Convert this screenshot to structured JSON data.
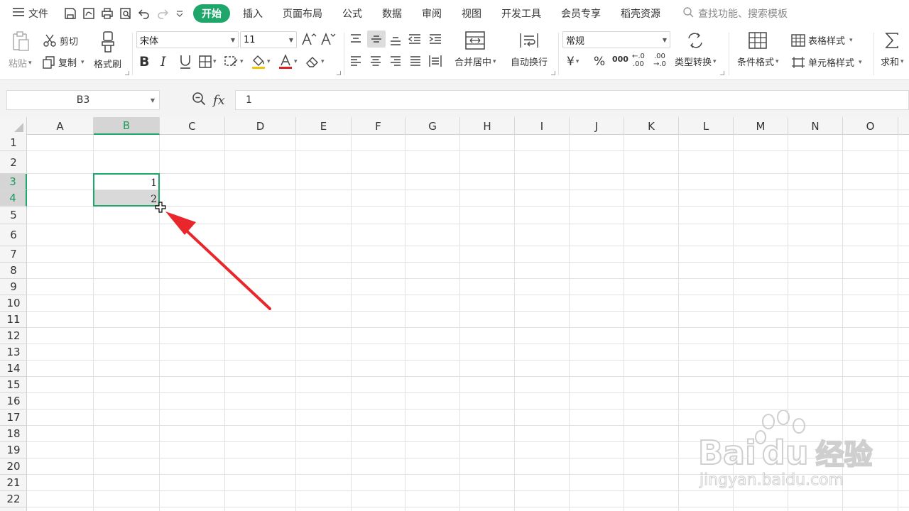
{
  "menubar": {
    "menu_label": "文件",
    "tabs": [
      {
        "label": "开始",
        "active": true
      },
      {
        "label": "插入"
      },
      {
        "label": "页面布局"
      },
      {
        "label": "公式"
      },
      {
        "label": "数据"
      },
      {
        "label": "审阅"
      },
      {
        "label": "视图"
      },
      {
        "label": "开发工具"
      },
      {
        "label": "会员专享"
      },
      {
        "label": "稻壳资源"
      }
    ],
    "search_placeholder": "查找功能、搜索模板"
  },
  "ribbon": {
    "paste": "粘贴",
    "cut": "剪切",
    "copy": "复制",
    "format_painter": "格式刷",
    "font_name": "宋体",
    "font_size": "11",
    "merge_center": "合并居中",
    "wrap_text": "自动换行",
    "number_format": "常规",
    "type_convert": "类型转换",
    "conditional_format": "条件格式",
    "table_style": "表格样式",
    "cell_style": "单元格样式",
    "sum": "求和",
    "percent": "%",
    "thousands": "000",
    "dec_increase_top": "←.0",
    "dec_increase_bottom": ".00",
    "dec_decrease_top": ".00",
    "dec_decrease_bottom": "→.0",
    "currency": "¥"
  },
  "formula_bar": {
    "name_box": "B3",
    "fx_label": "fx",
    "content": "1"
  },
  "sheet": {
    "columns": [
      "A",
      "B",
      "C",
      "D",
      "E",
      "F",
      "G",
      "H",
      "I",
      "J",
      "K",
      "L",
      "M",
      "N",
      "O"
    ],
    "rows": [
      "1",
      "2",
      "3",
      "4",
      "5",
      "6",
      "7",
      "8",
      "9",
      "10",
      "11",
      "12",
      "13",
      "14",
      "15",
      "16",
      "17",
      "18",
      "19",
      "20",
      "21",
      "22"
    ],
    "selected_column": "B",
    "selected_rows": [
      "3",
      "4"
    ],
    "cells": {
      "B3": "1",
      "B4": "2"
    }
  },
  "watermark": {
    "brand": "Bai",
    "brand2": "du",
    "brand_cn": "经验",
    "url": "jingyan.baidu.com"
  },
  "colors": {
    "accent": "#1fa66a",
    "arrow": "#e8262b"
  }
}
